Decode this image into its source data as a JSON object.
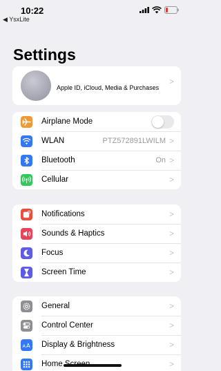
{
  "status": {
    "time": "10:22",
    "back_app": "◀ YsxLite"
  },
  "title": "Settings",
  "profile": {
    "label": "Apple ID, iCloud, Media & Purchases"
  },
  "connectivity": [
    {
      "label": "Airplane Mode",
      "icon": "airplane-icon",
      "color": "#f09a37"
    },
    {
      "label": "WLAN",
      "value": "PTZ572891LWILM",
      "icon": "wifi-icon",
      "color": "#3478f6"
    },
    {
      "label": "Bluetooth",
      "value": "On",
      "icon": "bluetooth-icon",
      "color": "#3478f6"
    },
    {
      "label": "Cellular",
      "icon": "cellular-icon",
      "color": "#34c759"
    }
  ],
  "alerts": [
    {
      "label": "Notifications",
      "icon": "notifications-icon",
      "color": "#eb4d3d"
    },
    {
      "label": "Sounds & Haptics",
      "icon": "speaker-icon",
      "color": "#eb445a"
    },
    {
      "label": "Focus",
      "icon": "moon-icon",
      "color": "#5e5ce6"
    },
    {
      "label": "Screen Time",
      "icon": "hourglass-icon",
      "color": "#5e5ce6"
    }
  ],
  "general": [
    {
      "label": "General",
      "icon": "gear-icon",
      "color": "#8e8e93"
    },
    {
      "label": "Control Center",
      "icon": "toggles-icon",
      "color": "#8e8e93"
    },
    {
      "label": "Display & Brightness",
      "icon": "text-size-icon",
      "color": "#3478f6"
    },
    {
      "label": "Home Screen",
      "icon": "app-grid-icon",
      "color": "#3478f6"
    }
  ],
  "airplane_mode_on": false
}
